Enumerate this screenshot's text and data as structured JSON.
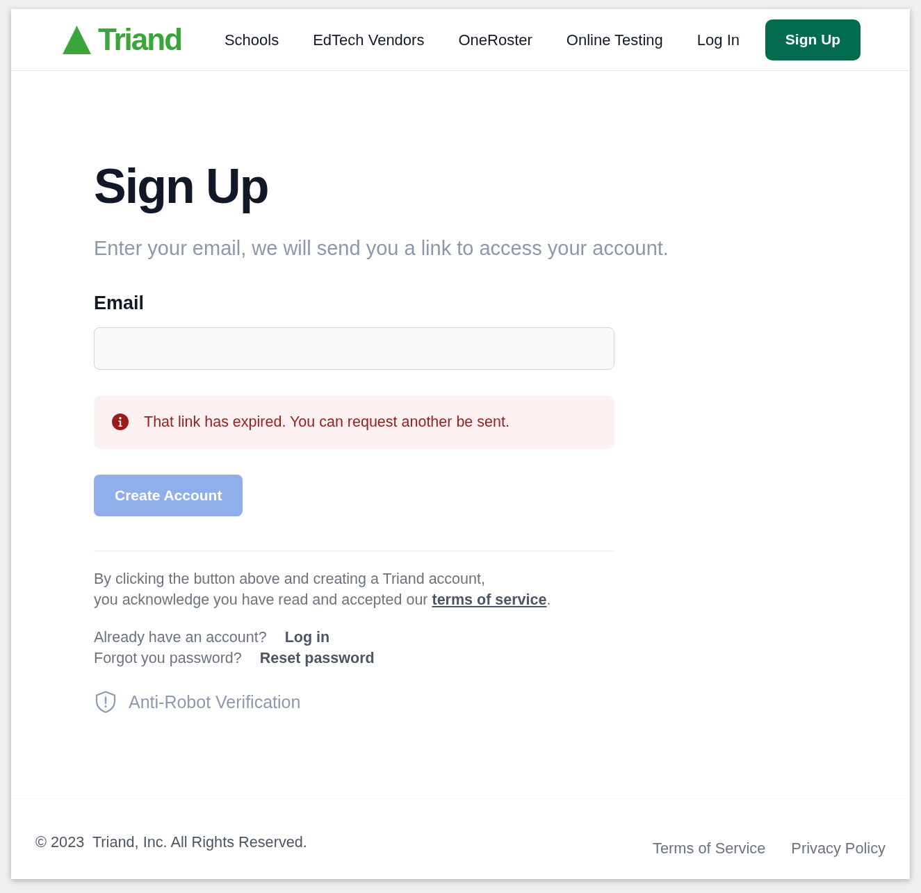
{
  "nav": {
    "logo": "Triand",
    "links": [
      {
        "label": "Schools"
      },
      {
        "label": "EdTech Vendors"
      },
      {
        "label": "OneRoster"
      },
      {
        "label": "Online Testing"
      },
      {
        "label": "Log In"
      }
    ],
    "signup_button": "Sign Up"
  },
  "form": {
    "title": "Sign Up",
    "subtitle": "Enter your email, we will send you a link to access your account.",
    "email": {
      "label": "Email"
    },
    "alert": {
      "message": "That link has expired. You can request another be sent."
    },
    "submit": {
      "label": "Create Account",
      "disabled": true
    }
  },
  "terms": {
    "lines": [
      "By clicking the button above and creating a Triand account,",
      "you acknowledge you have read and accepted our"
    ],
    "link": "terms of service",
    "after": "."
  },
  "account_links": [
    {
      "prompt": "Already have an account?",
      "link": "Log in"
    },
    {
      "prompt": "Forgot you password?",
      "link": "Reset password"
    }
  ],
  "verification": {
    "label": "Anti-Robot Verification"
  },
  "footer": {
    "copyright": "© 2023  Triand, Inc. All Rights Reserved.",
    "links": [
      "Terms of Service",
      "Privacy Policy"
    ]
  }
}
